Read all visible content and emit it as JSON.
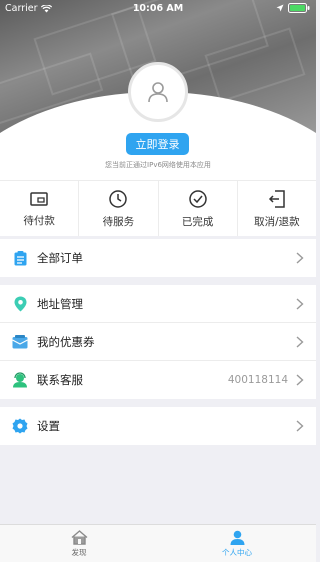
{
  "status_bar": {
    "carrier": "Carrier",
    "time": "10:06 AM"
  },
  "profile": {
    "login_label": "立即登录",
    "hint": "您当前正通过IPv6网络使用本应用"
  },
  "orders": [
    {
      "label": "待付款",
      "icon": "wallet-icon"
    },
    {
      "label": "待服务",
      "icon": "clock-icon"
    },
    {
      "label": "已完成",
      "icon": "check-circle-icon"
    },
    {
      "label": "取消/退款",
      "icon": "refund-icon"
    }
  ],
  "menu": {
    "all_orders": "全部订单",
    "address": "地址管理",
    "coupons": "我的优惠券",
    "support": "联系客服",
    "support_phone": "400118114",
    "settings": "设置"
  },
  "tabbar": {
    "discover": "发现",
    "profile": "个人中心",
    "active_color": "#2fa4f0"
  }
}
